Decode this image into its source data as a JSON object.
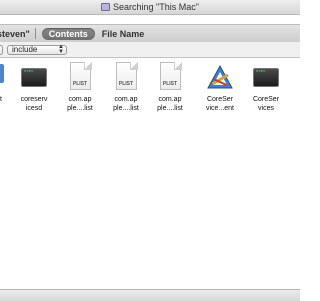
{
  "window": {
    "title": "Searching \"This Mac\""
  },
  "scope_bar": {
    "user_label": "steven\"",
    "active_filter": "Contents",
    "inactive_filter": "File Name"
  },
  "criteria": {
    "attribute_value": "include"
  },
  "results": [
    {
      "label_line1": "coreserv",
      "label_line2": "icesd",
      "kind": "executable"
    },
    {
      "label_line1": "com.ap",
      "label_line2": "ple....list",
      "kind": "plist",
      "tag": "PLIST"
    },
    {
      "label_line1": "com.ap",
      "label_line2": "ple....list",
      "kind": "plist",
      "tag": "PLIST"
    },
    {
      "label_line1": "com.ap",
      "label_line2": "ple....list",
      "kind": "plist",
      "tag": "PLIST"
    },
    {
      "label_line1": "CoreSer",
      "label_line2": "vice...ent",
      "kind": "application"
    },
    {
      "label_line1": "CoreSer",
      "label_line2": "vices",
      "kind": "executable"
    }
  ],
  "partial_item": {
    "label_line2": "t"
  },
  "colors": {
    "accent": "#4f86c9",
    "pill": "#7a7a7a"
  }
}
